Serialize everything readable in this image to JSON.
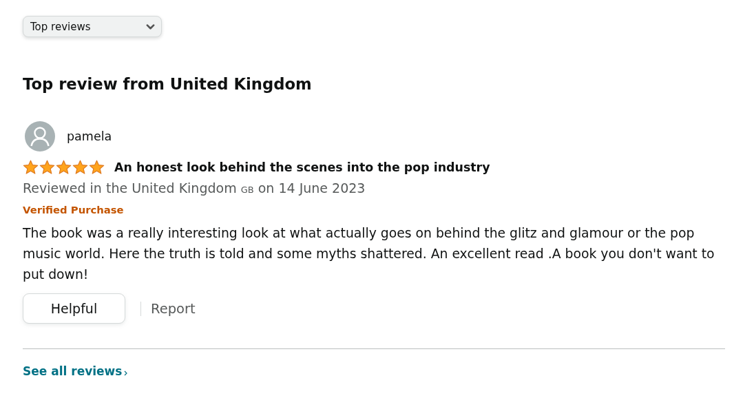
{
  "sort_dropdown": {
    "value": "Top reviews"
  },
  "section_title": "Top review from United Kingdom",
  "review": {
    "reviewer": "pamela",
    "stars": 5,
    "title": "An honest look behind the scenes into the pop industry",
    "reviewed_in": "Reviewed in the United Kingdom",
    "country_code": "GB",
    "date_text": "on 14 June 2023",
    "badge": "Verified Purchase",
    "body": "The book was a really interesting look at what actually goes on behind the glitz and glamour or the pop music world. Here the truth is told and some myths shattered. An excellent read .A book you don't want to put down!",
    "actions": [
      {
        "kind": "button",
        "label": "Helpful"
      },
      {
        "kind": "link",
        "label": "Report"
      }
    ]
  },
  "footer_link": "See all reviews"
}
